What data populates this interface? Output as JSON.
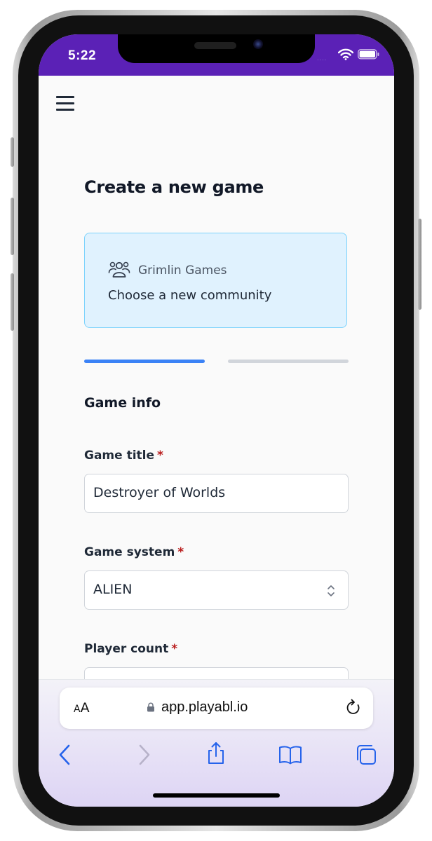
{
  "status_bar": {
    "time": "5:22",
    "signal_dots": "....",
    "accent_color": "#5b21b6"
  },
  "menu": {
    "icon": "hamburger-menu-icon"
  },
  "page": {
    "title": "Create a new game"
  },
  "community": {
    "icon": "users-icon",
    "name": "Grimlin Games",
    "link_text": "Choose a new community",
    "background_color": "#e0f2fe"
  },
  "steps": {
    "total": 2,
    "current": 1,
    "active_color": "#3b82f6",
    "inactive_color": "#d1d5db"
  },
  "form": {
    "section_title": "Game info",
    "required_marker": "*",
    "game_title": {
      "label": "Game title",
      "value": "Destroyer of Worlds"
    },
    "game_system": {
      "label": "Game system",
      "value": "ALIEN"
    },
    "player_count": {
      "label": "Player count",
      "value": ""
    }
  },
  "browser": {
    "text_size_big": "A",
    "text_size_small": "A",
    "url": "app.playabl.io",
    "toolbar_icons": [
      "back-icon",
      "forward-icon",
      "share-icon",
      "bookmarks-icon",
      "tabs-icon"
    ]
  }
}
